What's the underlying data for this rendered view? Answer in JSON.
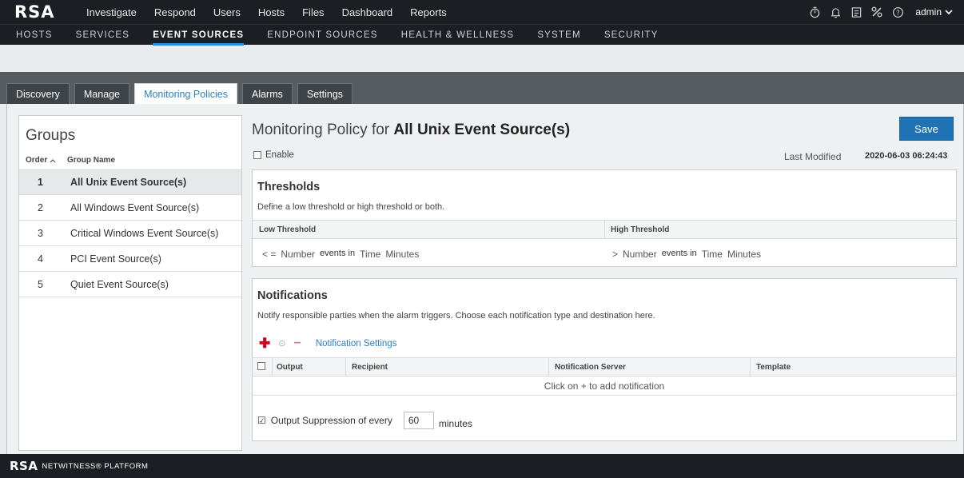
{
  "app": {
    "logo": "RSA"
  },
  "top_nav": [
    "Investigate",
    "Respond",
    "Users",
    "Hosts",
    "Files",
    "Dashboard",
    "Reports"
  ],
  "top_icons": [
    "timer-icon",
    "bell-icon",
    "notes-icon",
    "tools-icon",
    "help-icon"
  ],
  "user": {
    "name": "admin"
  },
  "sub_nav": [
    {
      "label": "HOSTS",
      "active": false
    },
    {
      "label": "SERVICES",
      "active": false
    },
    {
      "label": "EVENT SOURCES",
      "active": true
    },
    {
      "label": "ENDPOINT SOURCES",
      "active": false
    },
    {
      "label": "HEALTH & WELLNESS",
      "active": false
    },
    {
      "label": "SYSTEM",
      "active": false
    },
    {
      "label": "SECURITY",
      "active": false
    }
  ],
  "tabs": [
    {
      "label": "Discovery",
      "active": false
    },
    {
      "label": "Manage",
      "active": false
    },
    {
      "label": "Monitoring Policies",
      "active": true
    },
    {
      "label": "Alarms",
      "active": false
    },
    {
      "label": "Settings",
      "active": false
    }
  ],
  "groups": {
    "title": "Groups",
    "col_order": "Order",
    "col_name": "Group Name",
    "rows": [
      {
        "order": "1",
        "name": "All Unix Event Source(s)",
        "selected": true
      },
      {
        "order": "2",
        "name": "All Windows Event Source(s)",
        "selected": false
      },
      {
        "order": "3",
        "name": "Critical Windows Event Source(s)",
        "selected": false
      },
      {
        "order": "4",
        "name": "PCI Event Source(s)",
        "selected": false
      },
      {
        "order": "5",
        "name": "Quiet Event Source(s)",
        "selected": false
      }
    ]
  },
  "policy": {
    "title_prefix": "Monitoring Policy for",
    "title_group": "All Unix Event Source(s)",
    "save_label": "Save",
    "enable_label": "Enable",
    "last_modified_label": "Last Modified",
    "last_modified_value": "2020-06-03 06:24:43"
  },
  "thresholds": {
    "title": "Thresholds",
    "description": "Define a low threshold or high threshold or both.",
    "low_header": "Low Threshold",
    "high_header": "High Threshold",
    "low": {
      "operator": "< =",
      "number": "Number",
      "events_in": "events in",
      "time": "Time",
      "unit": "Minutes"
    },
    "high": {
      "operator": ">",
      "number": "Number",
      "events_in": "events in",
      "time": "Time",
      "unit": "Minutes"
    }
  },
  "notifications": {
    "title": "Notifications",
    "description": "Notify responsible parties when the alarm triggers. Choose each notification type and destination here.",
    "settings_link": "Notification Settings",
    "columns": [
      "Output",
      "Recipient",
      "Notification Server",
      "Template"
    ],
    "empty_message": "Click on + to add notification",
    "suppression_label": "Output Suppression of every",
    "suppression_value": "60",
    "suppression_unit": "minutes"
  },
  "footer": {
    "logo": "RSA",
    "product": "NETWITNESS® PLATFORM"
  }
}
